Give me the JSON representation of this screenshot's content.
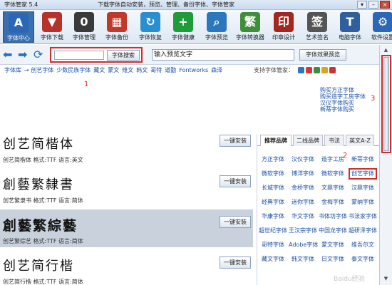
{
  "app": {
    "title": "字体管家 5.4",
    "tagline": "下载字体自动安装，预览、管理、备份字体、字体管家"
  },
  "window_buttons": [
    "▾",
    "–",
    "×"
  ],
  "toolbar": [
    {
      "label": "字体中心",
      "icon": "A",
      "color": "#2b67b6"
    },
    {
      "label": "字体下载",
      "icon": "▼",
      "color": "#b7322a"
    },
    {
      "label": "字体管理",
      "icon": "0",
      "color": "#3a3a3a"
    },
    {
      "label": "字体备份",
      "icon": "▦",
      "color": "#c0392b"
    },
    {
      "label": "字体恢复",
      "icon": "↻",
      "color": "#2a8fd0"
    },
    {
      "label": "字体健康",
      "icon": "+",
      "color": "#1f9b3a"
    },
    {
      "label": "字体预览",
      "icon": "⌕",
      "color": "#2a77c0"
    },
    {
      "label": "字体转换器",
      "icon": "繁",
      "color": "#3f8f3a"
    },
    {
      "label": "印章设计",
      "icon": "印",
      "color": "#a3271f"
    },
    {
      "label": "艺术签名",
      "icon": "签",
      "color": "#555555"
    },
    {
      "label": "电脑字体",
      "icon": "T",
      "color": "#2f5f9c"
    },
    {
      "label": "软件设置",
      "icon": "⚙",
      "color": "#2b67b6"
    }
  ],
  "search": {
    "button": "字体搜索",
    "preview_placeholder": "输入预览文字",
    "preview_button": "字体效果预览"
  },
  "categories": [
    "字体库",
    "→ 创艺字体",
    "少数民族字体",
    "藏文",
    "蒙文",
    "维文",
    "韩文",
    "哥特",
    "道勤",
    "Fontworks",
    "森泽"
  ],
  "supported_label": "支持字体管家：",
  "supported_colors": [
    "#2a77c0",
    "#d33",
    "#3a8f3a",
    "#e0a020",
    "#c33"
  ],
  "links": [
    "购买方正字体",
    "购买造字工房字体",
    "汉仪字体购买",
    "新蒂字体购买"
  ],
  "annotations": [
    "1",
    "2",
    "3"
  ],
  "fonts": [
    {
      "name": "创艺简楷体",
      "meta": "创艺简楷体 格式:TTF 语言:英文",
      "button": "一键安装",
      "bold": false,
      "selected": false
    },
    {
      "name": "創藝繁隸書",
      "meta": "创艺繁隶书 格式:TTF 语言:简体",
      "button": "一键安装",
      "bold": false,
      "selected": false
    },
    {
      "name": "創藝繁綜藝",
      "meta": "创艺繁综艺 格式:TTF 语言:简体",
      "button": "一键安装",
      "bold": true,
      "selected": true
    },
    {
      "name": "创艺简行楷",
      "meta": "创艺简行楷 格式:TTF 语言:简体",
      "button": "一键安装",
      "bold": false,
      "selected": false
    }
  ],
  "panel": {
    "tabs": [
      "推荐品牌",
      "二线品牌",
      "书法",
      "英文A-Z"
    ],
    "brands": [
      "方正字体",
      "汉仪字体",
      "造字工房",
      "新蒂字体",
      "微软字体",
      "博洋字体",
      "微软字体",
      "创艺字体",
      "长城字体",
      "金桥字体",
      "文鼎字体",
      "汉鼎字体",
      "经典字体",
      "迷你字体",
      "金梅字体",
      "蒙纳字体",
      "华康字体",
      "华文字体",
      "书体坊字体",
      "书法家字体",
      "超世纪字体",
      "王汉宗字体",
      "中国龙字体",
      "超研泽字体",
      "哥特字体",
      "Adobe字体",
      "蒙文字体",
      "维吾尔文",
      "藏文字体",
      "韩文字体",
      "日文字体",
      "泰文字体"
    ],
    "highlight_index": 7
  },
  "watermark": "Baidu经验"
}
